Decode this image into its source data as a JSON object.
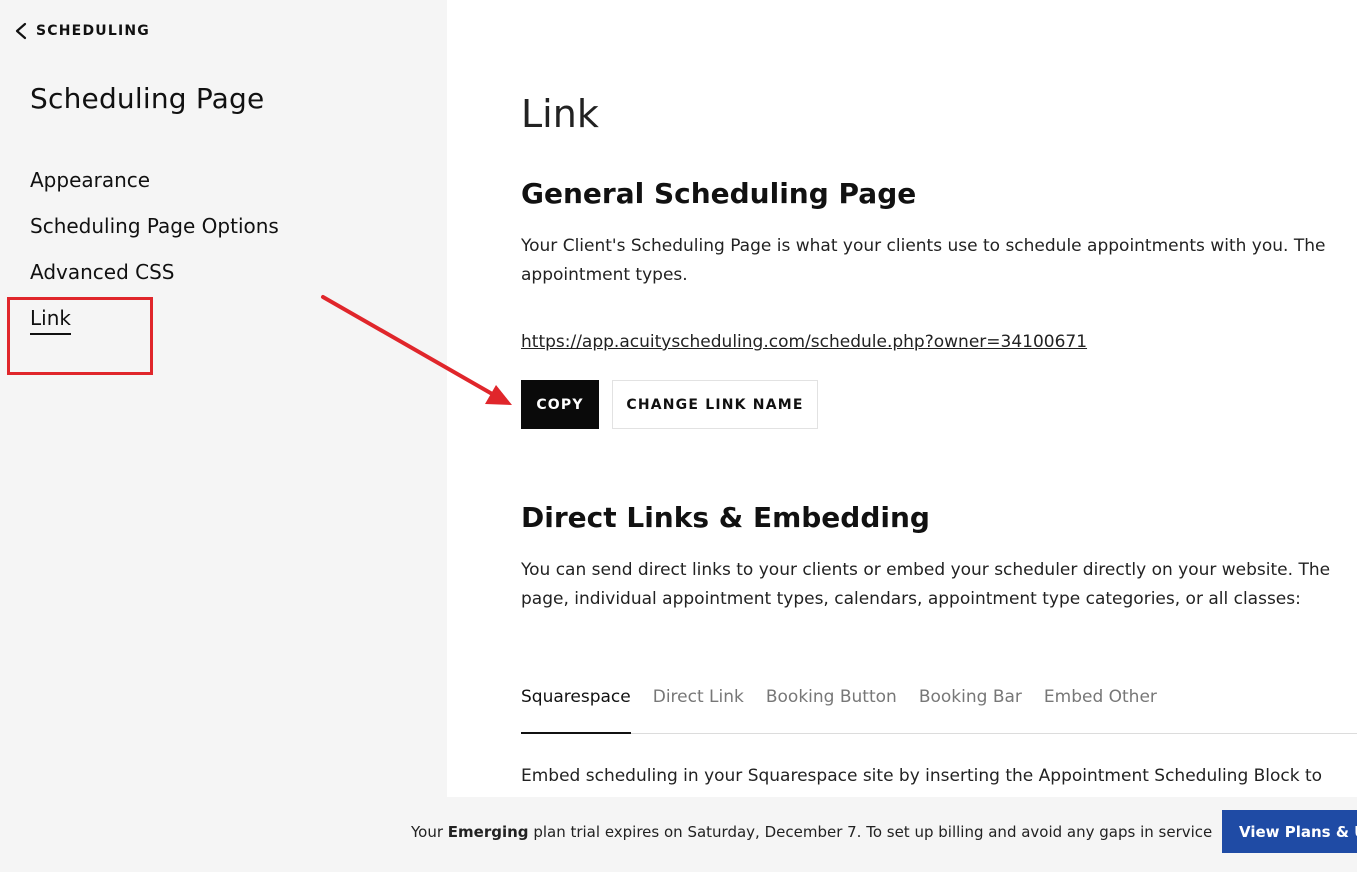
{
  "sidebar": {
    "back_label": "SCHEDULING",
    "title": "Scheduling Page",
    "items": [
      {
        "label": "Appearance"
      },
      {
        "label": "Scheduling Page Options"
      },
      {
        "label": "Advanced CSS"
      },
      {
        "label": "Link",
        "active": true
      }
    ]
  },
  "main": {
    "title": "Link",
    "general": {
      "heading": "General Scheduling Page",
      "description_line1": "Your Client's Scheduling Page is what your clients use to schedule appointments with you. The",
      "description_line2": "appointment types.",
      "url": "https://app.acuityscheduling.com/schedule.php?owner=34100671",
      "copy_label": "COPY",
      "change_link_label": "CHANGE LINK NAME"
    },
    "direct": {
      "heading": "Direct Links & Embedding",
      "description_line1": "You can send direct links to your clients or embed your scheduler directly on your website. The",
      "description_line2": "page, individual appointment types, calendars, appointment type categories, or all classes:"
    },
    "tabs": [
      {
        "label": "Squarespace",
        "active": true
      },
      {
        "label": "Direct Link"
      },
      {
        "label": "Booking Button"
      },
      {
        "label": "Booking Bar"
      },
      {
        "label": "Embed Other"
      }
    ],
    "tab_content": "Embed scheduling in your Squarespace site by inserting the Appointment Scheduling Block to"
  },
  "footer": {
    "text_before": "Your ",
    "plan_name": "Emerging",
    "text_after": " plan trial expires on Saturday, December 7.   To set up billing and avoid any gaps in service",
    "button_label": "View Plans & Upgrade"
  },
  "colors": {
    "annotation": "#e0262b",
    "primary_button": "#0a0a0a",
    "footer_button": "#1f4ba5",
    "sidebar_bg": "#f5f5f5"
  }
}
